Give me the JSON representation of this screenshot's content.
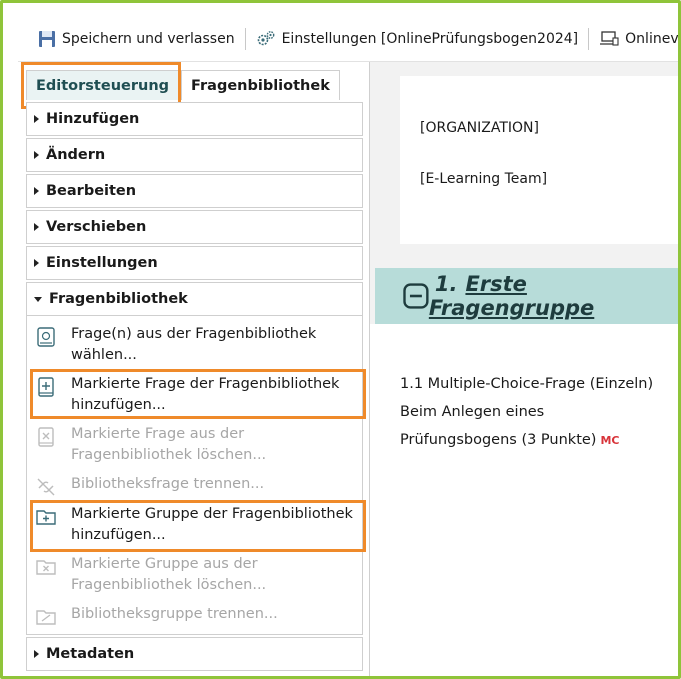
{
  "toolbar": {
    "save_label": "Speichern und verlassen",
    "settings_label": "Einstellungen [OnlinePrüfungsbogen2024]",
    "online_label": "Onlinevo"
  },
  "tabs": [
    {
      "label": "Editorsteuerung",
      "active": true
    },
    {
      "label": "Fragenbibliothek",
      "active": false
    }
  ],
  "accordion": {
    "hinzufuegen": "Hinzufügen",
    "aendern": "Ändern",
    "bearbeiten": "Bearbeiten",
    "verschieben": "Verschieben",
    "einstellungen": "Einstellungen",
    "fragenbibliothek": "Fragenbibliothek",
    "metadaten": "Metadaten"
  },
  "library_items": [
    {
      "label": "Frage(n) aus der Fragenbibliothek wählen...",
      "icon": "book-icon",
      "enabled": true
    },
    {
      "label": "Markierte Frage der Fragenbibliothek hinzufügen...",
      "icon": "book-plus-icon",
      "enabled": true
    },
    {
      "label": "Markierte Frage aus der Fragenbibliothek löschen...",
      "icon": "book-x-icon",
      "enabled": false
    },
    {
      "label": "Bibliotheksfrage trennen...",
      "icon": "unlink-icon",
      "enabled": false
    },
    {
      "label": "Markierte Gruppe der Fragenbibliothek hinzufügen...",
      "icon": "folder-plus-icon",
      "enabled": true
    },
    {
      "label": "Markierte Gruppe aus der Fragenbibliothek löschen...",
      "icon": "folder-x-icon",
      "enabled": false
    },
    {
      "label": "Bibliotheksgruppe trennen...",
      "icon": "folder-unlink-icon",
      "enabled": false
    }
  ],
  "content": {
    "org": "[ORGANIZATION]",
    "team": "[E-Learning Team]",
    "group_number": "1.",
    "group_name": "Erste Fragengruppe",
    "question_line1": "1.1 Multiple-Choice-Frage (Einzeln)",
    "question_line2": "Beim Anlegen eines",
    "question_line3": "Prüfungsbogens (3 Punkte)",
    "question_badge": "MC"
  },
  "colors": {
    "highlight": "#ef8a2a",
    "frame": "#8fc43a",
    "group_bar": "#b7dcd9",
    "badge": "#d8343a"
  }
}
